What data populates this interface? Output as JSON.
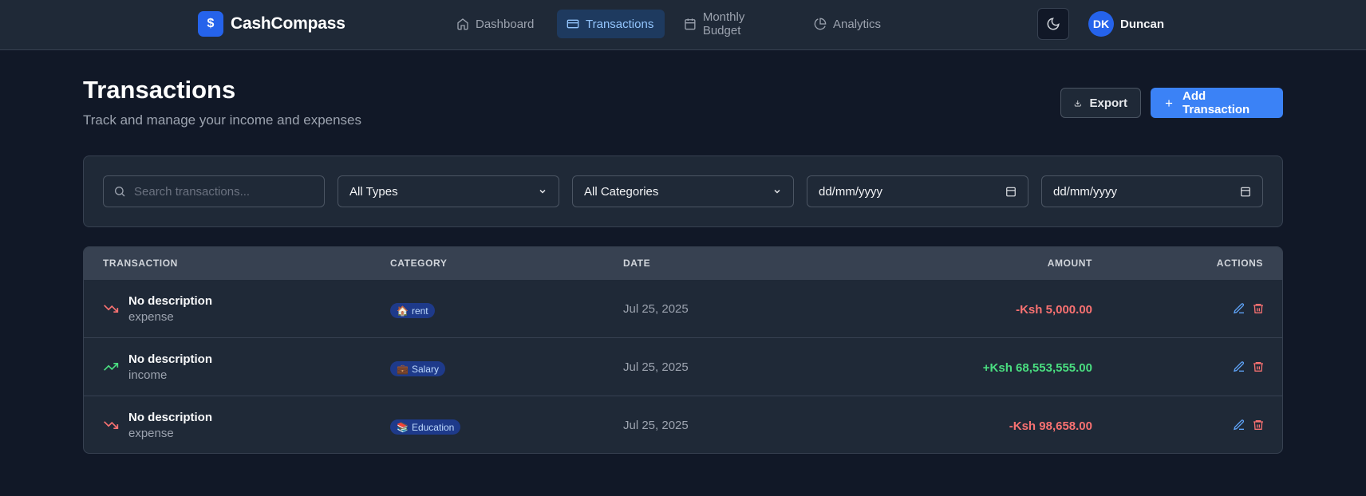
{
  "app": {
    "logo_symbol": "$",
    "name": "CashCompass"
  },
  "nav": [
    {
      "label": "Dashboard",
      "icon": "home-icon",
      "active": false
    },
    {
      "label": "Transactions",
      "icon": "credit-card-icon",
      "active": true
    },
    {
      "label": "Monthly Budget",
      "icon": "calendar-icon",
      "active": false
    },
    {
      "label": "Analytics",
      "icon": "pie-chart-icon",
      "active": false
    }
  ],
  "user": {
    "initials": "DK",
    "name": "Duncan"
  },
  "page": {
    "title": "Transactions",
    "subtitle": "Track and manage your income and expenses"
  },
  "actions": {
    "export_label": "Export",
    "add_label": "Add Transaction"
  },
  "filters": {
    "search_placeholder": "Search transactions...",
    "type_value": "All Types",
    "category_value": "All Categories",
    "date_from": "dd/mm/yyyy",
    "date_to": "dd/mm/yyyy"
  },
  "table": {
    "headers": {
      "transaction": "TRANSACTION",
      "category": "CATEGORY",
      "date": "DATE",
      "amount": "AMOUNT",
      "actions": "ACTIONS"
    },
    "rows": [
      {
        "description": "No description",
        "type": "expense",
        "category_emoji": "🏠",
        "category": "rent",
        "date": "Jul 25, 2025",
        "amount": "-Ksh 5,000.00"
      },
      {
        "description": "No description",
        "type": "income",
        "category_emoji": "💼",
        "category": "Salary",
        "date": "Jul 25, 2025",
        "amount": "+Ksh 68,553,555.00"
      },
      {
        "description": "No description",
        "type": "expense",
        "category_emoji": "📚",
        "category": "Education",
        "date": "Jul 25, 2025",
        "amount": "-Ksh 98,658.00"
      }
    ]
  },
  "colors": {
    "accent": "#3b82f6",
    "expense": "#f87171",
    "income": "#4ade80",
    "background": "#111827"
  }
}
